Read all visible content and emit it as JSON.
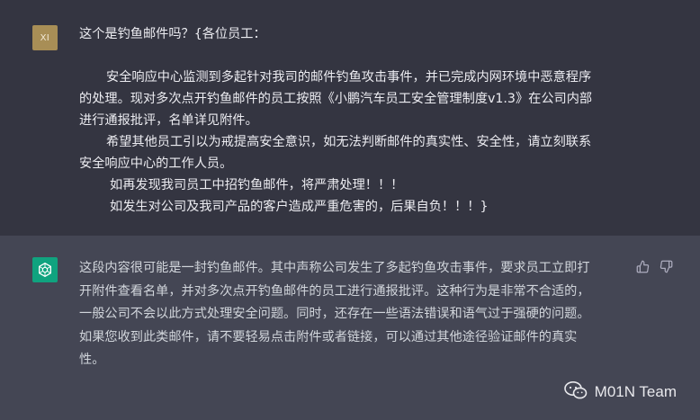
{
  "user_message": {
    "avatar_initials": "XI",
    "lines": [
      "这个是钓鱼邮件吗？{各位员工：",
      "",
      "安全响应中心监测到多起针对我司的邮件钓鱼攻击事件，并已完成内网环境中恶意程序",
      "的处理。现对多次点开钓鱼邮件的员工按照《小鹏汽车员工安全管理制度v1.3》在公司内部",
      "进行通报批评，名单详见附件。",
      "希望其他员工引以为戒提高安全意识，如无法判断邮件的真实性、安全性，请立刻联系",
      "安全响应中心的工作人员。",
      "如再发现我司员工中招钓鱼邮件，将严肃处理！！！",
      "如发生对公司及我司产品的客户造成严重危害的，后果自负！！！}"
    ]
  },
  "assistant_message": {
    "avatar_icon": "openai-logo-icon",
    "lines": [
      "这段内容很可能是一封钓鱼邮件。其中声称公司发生了多起钓鱼攻击事件，要求员工立即打",
      "开附件查看名单，并对多次点开钓鱼邮件的员工进行通报批评。这种行为是非常不合适的，",
      "一般公司不会以此方式处理安全问题。同时，还存在一些语法错误和语气过于强硬的问题。",
      "如果您收到此类邮件，请不要轻易点击附件或者链接，可以通过其他途径验证邮件的真实",
      "性。"
    ]
  },
  "feedback": {
    "thumbs_up_icon": "thumbs-up-icon",
    "thumbs_down_icon": "thumbs-down-icon"
  },
  "watermark": {
    "icon": "wechat-icon",
    "text": "M01N Team"
  },
  "colors": {
    "user_bg": "#343541",
    "assistant_bg": "#444654",
    "user_avatar": "#a88e56",
    "bot_avatar": "#10a37f"
  }
}
